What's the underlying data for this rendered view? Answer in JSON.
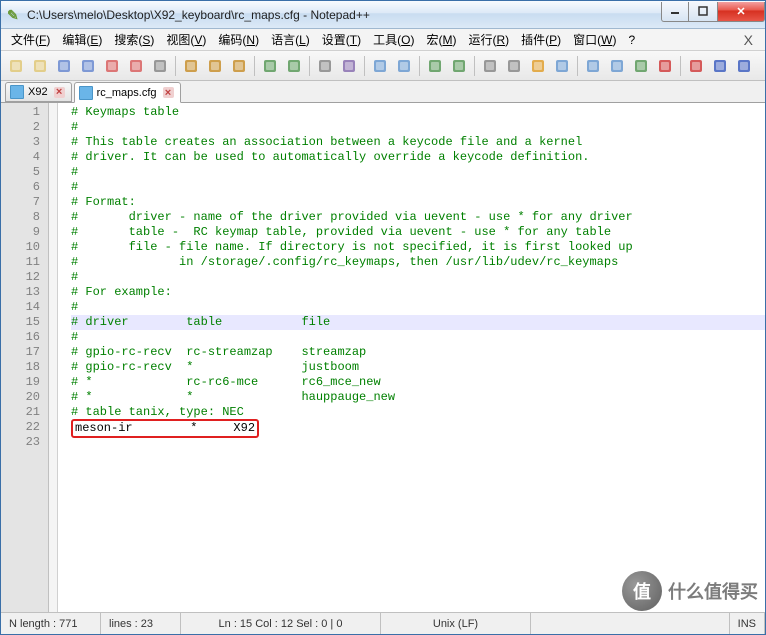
{
  "title": "C:\\Users\\melo\\Desktop\\X92_keyboard\\rc_maps.cfg - Notepad++",
  "menus": [
    "文件(F)",
    "编辑(E)",
    "搜索(S)",
    "视图(V)",
    "编码(N)",
    "语言(L)",
    "设置(T)",
    "工具(O)",
    "宏(M)",
    "运行(R)",
    "插件(P)",
    "窗口(W)",
    "?"
  ],
  "menu_close": "X",
  "tabs": [
    {
      "label": "X92",
      "active": false
    },
    {
      "label": "rc_maps.cfg",
      "active": true
    }
  ],
  "lines": [
    {
      "n": 1,
      "t": "# Keymaps table",
      "c": "comment"
    },
    {
      "n": 2,
      "t": "#",
      "c": "comment"
    },
    {
      "n": 3,
      "t": "# This table creates an association between a keycode file and a kernel",
      "c": "comment"
    },
    {
      "n": 4,
      "t": "# driver. It can be used to automatically override a keycode definition.",
      "c": "comment"
    },
    {
      "n": 5,
      "t": "#",
      "c": "comment"
    },
    {
      "n": 6,
      "t": "#",
      "c": "comment"
    },
    {
      "n": 7,
      "t": "# Format:",
      "c": "comment"
    },
    {
      "n": 8,
      "t": "#       driver - name of the driver provided via uevent - use * for any driver",
      "c": "comment"
    },
    {
      "n": 9,
      "t": "#       table -  RC keymap table, provided via uevent - use * for any table",
      "c": "comment"
    },
    {
      "n": 10,
      "t": "#       file - file name. If directory is not specified, it is first looked up",
      "c": "comment"
    },
    {
      "n": 11,
      "t": "#              in /storage/.config/rc_keymaps, then /usr/lib/udev/rc_keymaps",
      "c": "comment"
    },
    {
      "n": 12,
      "t": "#",
      "c": "comment"
    },
    {
      "n": 13,
      "t": "# For example:",
      "c": "comment"
    },
    {
      "n": 14,
      "t": "#",
      "c": "comment"
    },
    {
      "n": 15,
      "t": "# driver        table           file",
      "c": "comment",
      "hl": true
    },
    {
      "n": 16,
      "t": "#",
      "c": "comment"
    },
    {
      "n": 17,
      "t": "# gpio-rc-recv  rc-streamzap    streamzap",
      "c": "comment"
    },
    {
      "n": 18,
      "t": "# gpio-rc-recv  *               justboom",
      "c": "comment"
    },
    {
      "n": 19,
      "t": "# *             rc-rc6-mce      rc6_mce_new",
      "c": "comment"
    },
    {
      "n": 20,
      "t": "# *             *               hauppauge_new",
      "c": "comment"
    },
    {
      "n": 21,
      "t": "# table tanix, type: NEC",
      "c": "comment"
    },
    {
      "n": 22,
      "t": "meson-ir        *     X92",
      "c": "plain",
      "box": true
    },
    {
      "n": 23,
      "t": "",
      "c": "plain"
    }
  ],
  "status": {
    "length": "N length : 771",
    "lines": "lines : 23",
    "pos": "Ln : 15   Col : 12   Sel : 0 | 0",
    "eol": "Unix (LF)",
    "ins": "INS"
  },
  "watermark": "什么值得买",
  "toolbar_icons": [
    "new-file-icon",
    "open-file-icon",
    "save-icon",
    "save-all-icon",
    "close-icon",
    "close-all-icon",
    "print-icon",
    "cut-icon",
    "copy-icon",
    "paste-icon",
    "undo-icon",
    "redo-icon",
    "find-icon",
    "replace-icon",
    "zoom-in-icon",
    "zoom-out-icon",
    "sync-v-icon",
    "sync-h-icon",
    "wrap-icon",
    "all-chars-icon",
    "indent-guide-icon",
    "lang-icon",
    "doc-map-icon",
    "func-list-icon",
    "folder-icon",
    "monitor-icon",
    "record-icon",
    "stop-icon",
    "play-icon"
  ],
  "toolbar_colors": [
    "#e0c878",
    "#e0c878",
    "#6a8ad0",
    "#6a8ad0",
    "#d86060",
    "#d86060",
    "#888",
    "#c89030",
    "#c89030",
    "#c89030",
    "#5a9a5a",
    "#5a9a5a",
    "#888",
    "#8a70b0",
    "#6a9ad0",
    "#6a9ad0",
    "#5a9a5a",
    "#5a9a5a",
    "#888",
    "#888",
    "#e0a030",
    "#6a9ad0",
    "#6a9ad0",
    "#6a9ad0",
    "#5a9a5a",
    "#d04040",
    "#d04040",
    "#4060c0",
    "#4060c0"
  ]
}
